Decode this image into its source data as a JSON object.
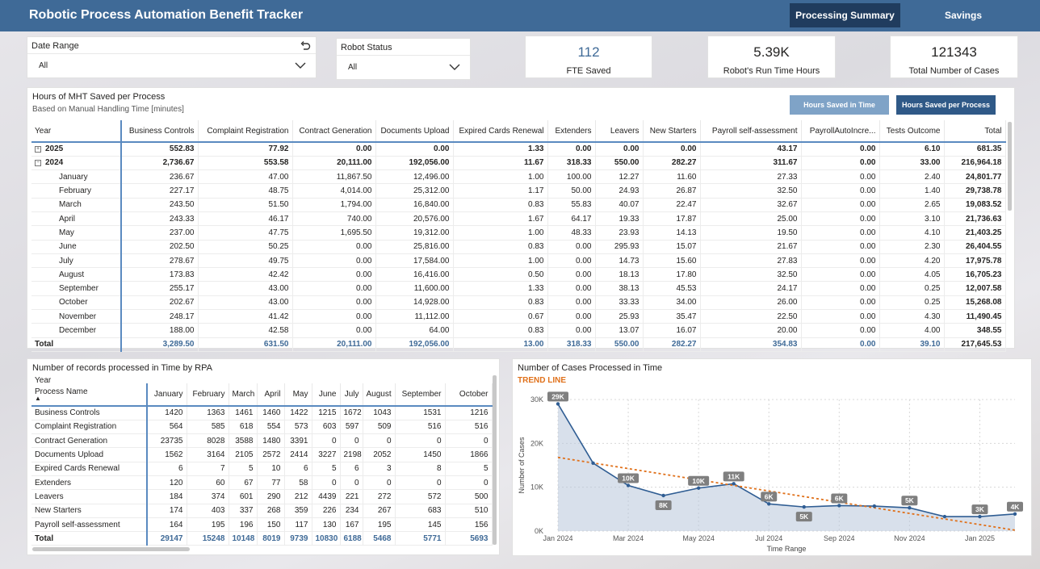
{
  "app_title": "Robotic Process Automation Benefit Tracker",
  "nav": {
    "processing_summary": "Processing Summary",
    "savings": "Savings"
  },
  "slicers": {
    "date_range": {
      "title": "Date Range",
      "value": "All"
    },
    "robot_status": {
      "title": "Robot Status",
      "value": "All"
    }
  },
  "kpis": {
    "fte_saved": {
      "value": "112",
      "label": "FTE Saved"
    },
    "run_time": {
      "value": "5.39K",
      "label": "Robot's Run Time Hours"
    },
    "total_cases": {
      "value": "121343",
      "label": "Total Number of Cases"
    }
  },
  "mht": {
    "title": "Hours of MHT Saved per Process",
    "subtitle": "Based on Manual Handling Time [minutes]",
    "btn_time": "Hours Saved in Time",
    "btn_process": "Hours Saved per Process",
    "columns": [
      "Year",
      "Business Controls",
      "Complaint Registration",
      "Contract Generation",
      "Documents Upload",
      "Expired Cards Renewal",
      "Extenders",
      "Leavers",
      "New Starters",
      "Payroll self-assessment",
      "PayrollAutoIncre...",
      "Tests Outcome",
      "Total"
    ],
    "rows": [
      {
        "kind": "year",
        "expander": "+",
        "cells": [
          "2025",
          "552.83",
          "77.92",
          "0.00",
          "0.00",
          "1.33",
          "0.00",
          "0.00",
          "0.00",
          "43.17",
          "0.00",
          "6.10",
          "681.35"
        ]
      },
      {
        "kind": "year",
        "expander": "−",
        "cells": [
          "2024",
          "2,736.67",
          "553.58",
          "20,111.00",
          "192,056.00",
          "11.67",
          "318.33",
          "550.00",
          "282.27",
          "311.67",
          "0.00",
          "33.00",
          "216,964.18"
        ]
      },
      {
        "kind": "month",
        "cells": [
          "January",
          "236.67",
          "47.00",
          "11,867.50",
          "12,496.00",
          "1.00",
          "100.00",
          "12.27",
          "11.60",
          "27.33",
          "0.00",
          "2.40",
          "24,801.77"
        ]
      },
      {
        "kind": "month",
        "cells": [
          "February",
          "227.17",
          "48.75",
          "4,014.00",
          "25,312.00",
          "1.17",
          "50.00",
          "24.93",
          "26.87",
          "32.50",
          "0.00",
          "1.40",
          "29,738.78"
        ]
      },
      {
        "kind": "month",
        "cells": [
          "March",
          "243.50",
          "51.50",
          "1,794.00",
          "16,840.00",
          "0.83",
          "55.83",
          "40.07",
          "22.47",
          "32.67",
          "0.00",
          "2.65",
          "19,083.52"
        ]
      },
      {
        "kind": "month",
        "cells": [
          "April",
          "243.33",
          "46.17",
          "740.00",
          "20,576.00",
          "1.67",
          "64.17",
          "19.33",
          "17.87",
          "25.00",
          "0.00",
          "3.10",
          "21,736.63"
        ]
      },
      {
        "kind": "month",
        "cells": [
          "May",
          "237.00",
          "47.75",
          "1,695.50",
          "19,312.00",
          "1.00",
          "48.33",
          "23.93",
          "14.13",
          "19.50",
          "0.00",
          "4.10",
          "21,403.25"
        ]
      },
      {
        "kind": "month",
        "cells": [
          "June",
          "202.50",
          "50.25",
          "0.00",
          "25,816.00",
          "0.83",
          "0.00",
          "295.93",
          "15.07",
          "21.67",
          "0.00",
          "2.30",
          "26,404.55"
        ]
      },
      {
        "kind": "month",
        "cells": [
          "July",
          "278.67",
          "49.75",
          "0.00",
          "17,584.00",
          "1.00",
          "0.00",
          "14.73",
          "15.60",
          "27.83",
          "0.00",
          "4.20",
          "17,975.78"
        ]
      },
      {
        "kind": "month",
        "cells": [
          "August",
          "173.83",
          "42.42",
          "0.00",
          "16,416.00",
          "0.50",
          "0.00",
          "18.13",
          "17.80",
          "32.50",
          "0.00",
          "4.05",
          "16,705.23"
        ]
      },
      {
        "kind": "month",
        "cells": [
          "September",
          "255.17",
          "43.00",
          "0.00",
          "11,600.00",
          "1.33",
          "0.00",
          "38.13",
          "45.53",
          "24.17",
          "0.00",
          "0.25",
          "12,007.58"
        ]
      },
      {
        "kind": "month",
        "cells": [
          "October",
          "202.67",
          "43.00",
          "0.00",
          "14,928.00",
          "0.83",
          "0.00",
          "33.33",
          "34.00",
          "26.00",
          "0.00",
          "0.25",
          "15,268.08"
        ]
      },
      {
        "kind": "month",
        "cells": [
          "November",
          "248.17",
          "41.42",
          "0.00",
          "11,112.00",
          "0.67",
          "0.00",
          "25.93",
          "35.47",
          "22.50",
          "0.00",
          "4.30",
          "11,490.45"
        ]
      },
      {
        "kind": "month",
        "cells": [
          "December",
          "188.00",
          "42.58",
          "0.00",
          "64.00",
          "0.83",
          "0.00",
          "13.07",
          "16.07",
          "20.00",
          "0.00",
          "4.00",
          "348.55"
        ]
      },
      {
        "kind": "tot",
        "cells": [
          "Total",
          "3,289.50",
          "631.50",
          "20,111.00",
          "192,056.00",
          "13.00",
          "318.33",
          "550.00",
          "282.27",
          "354.83",
          "0.00",
          "39.10",
          "217,645.53"
        ]
      }
    ]
  },
  "records": {
    "title": "Number of records processed in Time by RPA",
    "year_label": "Year",
    "columns": [
      "Process Name",
      "January",
      "February",
      "March",
      "April",
      "May",
      "June",
      "July",
      "August",
      "September",
      "October"
    ],
    "rows": [
      [
        "Business Controls",
        "1420",
        "1363",
        "1461",
        "1460",
        "1422",
        "1215",
        "1672",
        "1043",
        "1531",
        "1216"
      ],
      [
        "Complaint Registration",
        "564",
        "585",
        "618",
        "554",
        "573",
        "603",
        "597",
        "509",
        "516",
        "516"
      ],
      [
        "Contract Generation",
        "23735",
        "8028",
        "3588",
        "1480",
        "3391",
        "0",
        "0",
        "0",
        "0",
        "0"
      ],
      [
        "Documents Upload",
        "1562",
        "3164",
        "2105",
        "2572",
        "2414",
        "3227",
        "2198",
        "2052",
        "1450",
        "1866"
      ],
      [
        "Expired Cards Renewal",
        "6",
        "7",
        "5",
        "10",
        "6",
        "5",
        "6",
        "3",
        "8",
        "5"
      ],
      [
        "Extenders",
        "120",
        "60",
        "67",
        "77",
        "58",
        "0",
        "0",
        "0",
        "0",
        "0"
      ],
      [
        "Leavers",
        "184",
        "374",
        "601",
        "290",
        "212",
        "4439",
        "221",
        "272",
        "572",
        "500"
      ],
      [
        "New Starters",
        "174",
        "403",
        "337",
        "268",
        "359",
        "226",
        "234",
        "267",
        "683",
        "510"
      ],
      [
        "Payroll self-assessment",
        "164",
        "195",
        "196",
        "150",
        "117",
        "130",
        "167",
        "195",
        "145",
        "156"
      ]
    ],
    "total": [
      "Total",
      "29147",
      "15248",
      "10148",
      "8019",
      "9739",
      "10830",
      "6188",
      "5468",
      "5771",
      "5693"
    ]
  },
  "chart_data": {
    "type": "line",
    "title": "Number of Cases Processed in Time",
    "subtitle": "TREND LINE",
    "xlabel": "Time Range",
    "ylabel": "Number of Cases",
    "x_ticks": [
      "Jan 2024",
      "Mar 2024",
      "May 2024",
      "Jul 2024",
      "Sep 2024",
      "Nov 2024",
      "Jan 2025"
    ],
    "y_ticks": [
      "0K",
      "10K",
      "20K",
      "30K"
    ],
    "ylim": [
      0,
      30000
    ],
    "x": [
      "2024-01",
      "2024-02",
      "2024-03",
      "2024-04",
      "2024-05",
      "2024-06",
      "2024-07",
      "2024-08",
      "2024-09",
      "2024-10",
      "2024-11",
      "2024-12",
      "2025-01",
      "2025-02"
    ],
    "values": [
      29000,
      15500,
      10400,
      8100,
      9800,
      10800,
      6200,
      5500,
      5800,
      5700,
      5300,
      3300,
      3300,
      3900
    ],
    "data_labels": [
      "29K",
      "",
      "10K",
      "8K",
      "10K",
      "11K",
      "6K",
      "5K",
      "6K",
      "",
      "5K",
      "",
      "3K",
      "4K"
    ],
    "trend": {
      "start": 16800,
      "end": 200
    },
    "colors": {
      "line": "#2f5d93",
      "area": "#b8c6da",
      "trend": "#e0711b",
      "label_bg": "#7f7f7f"
    },
    "grid": true,
    "legend": "none"
  },
  "colors": {
    "header": "#3f6a97",
    "nav_active": "#203c5e",
    "btn_light": "#7fa3c7",
    "btn_dark": "#2f5987"
  }
}
